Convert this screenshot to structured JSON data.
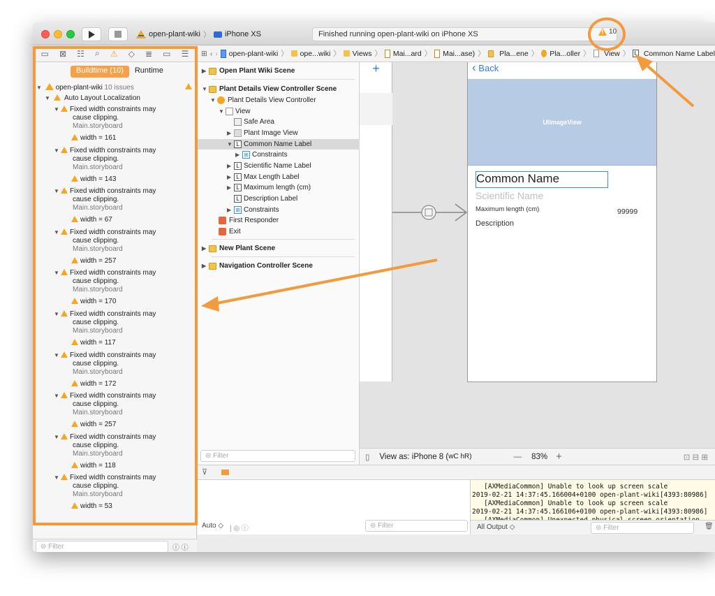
{
  "toolbar": {
    "scheme_name": "open-plant-wiki",
    "device": "iPhone XS",
    "status_text": "Finished running open-plant-wiki on iPhone XS",
    "warning_count": "10"
  },
  "jumpbar": {
    "items": [
      "open-plant-wiki",
      "ope...wiki",
      "Views",
      "Mai...ard",
      "Mai...ase)",
      "Pla...ene",
      "Pla...oller",
      "View",
      "Common Name Label"
    ]
  },
  "issue_navigator": {
    "tabs": [
      "Buildtime (10)",
      "Runtime"
    ],
    "project": "open-plant-wiki",
    "project_count": "10 issues",
    "category": "Auto Layout Localization",
    "issues": [
      {
        "line1": "Fixed width constraints may",
        "line2": "cause clipping.",
        "file": "Main.storyboard",
        "detail": "width = 161"
      },
      {
        "line1": "Fixed width constraints may",
        "line2": "cause clipping.",
        "file": "Main.storyboard",
        "detail": "width = 143"
      },
      {
        "line1": "Fixed width constraints may",
        "line2": "cause clipping.",
        "file": "Main.storyboard",
        "detail": "width = 67"
      },
      {
        "line1": "Fixed width constraints may",
        "line2": "cause clipping.",
        "file": "Main.storyboard",
        "detail": "width = 257"
      },
      {
        "line1": "Fixed width constraints may",
        "line2": "cause clipping.",
        "file": "Main.storyboard",
        "detail": "width = 170"
      },
      {
        "line1": "Fixed width constraints may",
        "line2": "cause clipping.",
        "file": "Main.storyboard",
        "detail": "width = 117"
      },
      {
        "line1": "Fixed width constraints may",
        "line2": "cause clipping.",
        "file": "Main.storyboard",
        "detail": "width = 172"
      },
      {
        "line1": "Fixed width constraints may",
        "line2": "cause clipping.",
        "file": "Main.storyboard",
        "detail": "width = 257"
      },
      {
        "line1": "Fixed width constraints may",
        "line2": "cause clipping.",
        "file": "Main.storyboard",
        "detail": "width = 118"
      },
      {
        "line1": "Fixed width constraints may",
        "line2": "cause clipping.",
        "file": "Main.storyboard",
        "detail": "width = 53"
      }
    ],
    "filter_placeholder": "Filter"
  },
  "outline": {
    "scene1": "Open Plant Wiki Scene",
    "scene2": "Plant Details View Controller Scene",
    "controller": "Plant Details View Controller",
    "view": "View",
    "safe_area": "Safe Area",
    "plant_image": "Plant Image View",
    "common_name": "Common Name Label",
    "constraints_inner": "Constraints",
    "scientific": "Scientific Name Label",
    "max_length": "Max Length Label",
    "maximum_length": "Maximum length (cm)",
    "description": "Description Label",
    "constraints": "Constraints",
    "first_responder": "First Responder",
    "exit": "Exit",
    "scene3": "New Plant Scene",
    "scene4": "Navigation Controller Scene",
    "filter_placeholder": "Filter"
  },
  "canvas": {
    "back_label": "Back",
    "image_view_label": "UIImageView",
    "common_name": "Common Name",
    "scientific_name": "Scientific Name",
    "max_length_label": "Maximum length (cm)",
    "max_length_value": "99999",
    "description": "Description",
    "view_as": "View as: iPhone 8 (",
    "size_class": "wC hR)",
    "zoom_minus": "—",
    "zoom": "83%",
    "zoom_plus": "+"
  },
  "debug": {
    "auto_label": "Auto ◇",
    "vars_filter": "Filter",
    "all_output": "All Output ◇",
    "console_filter": "Filter",
    "console_lines": [
      "   [AXMediaCommon] Unable to look up screen scale",
      "2019-02-21 14:37:45.166004+0100 open-plant-wiki[4393:80986]",
      "   [AXMediaCommon] Unable to look up screen scale",
      "2019-02-21 14:37:45.166106+0100 open-plant-wiki[4393:80986]",
      "   [AXMediaCommon] Unexpected physical screen orientation"
    ]
  },
  "colors": {
    "annotation": "#f39a3e",
    "warning": "#f5a623",
    "image_view": "#b8cbe4"
  }
}
